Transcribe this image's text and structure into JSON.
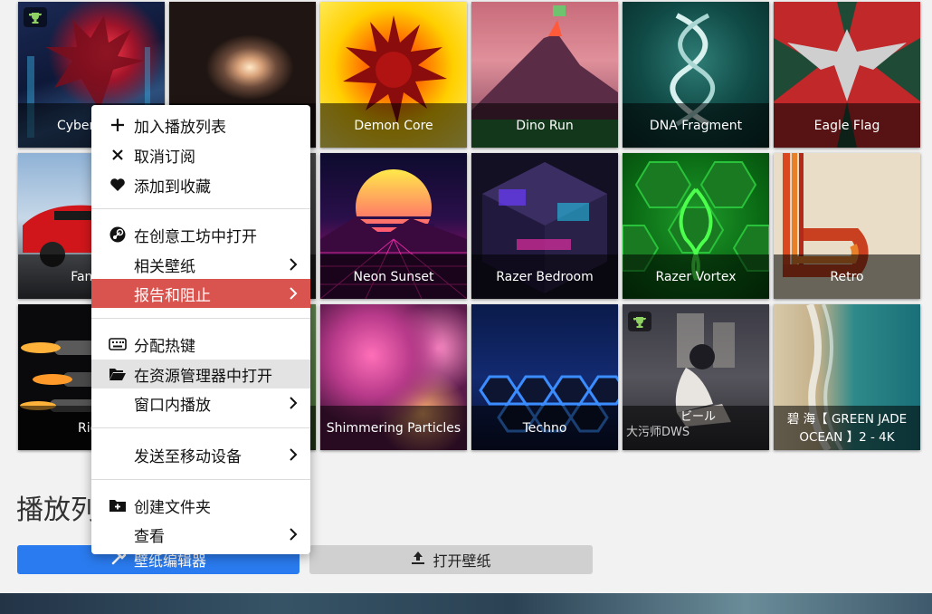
{
  "wallpapers": [
    {
      "title": "Cyberpunk",
      "selected": true,
      "trophy": true
    },
    {
      "title": ""
    },
    {
      "title": "Demon Core"
    },
    {
      "title": "Dino Run"
    },
    {
      "title": "DNA Fragment"
    },
    {
      "title": "Eagle Flag"
    },
    {
      "title": "Fantas"
    },
    {
      "title": ""
    },
    {
      "title": "Neon Sunset"
    },
    {
      "title": "Razer Bedroom"
    },
    {
      "title": "Razer Vortex"
    },
    {
      "title": "Retro"
    },
    {
      "title": "Rice"
    },
    {
      "title": ""
    },
    {
      "title": "Shimmering Particles"
    },
    {
      "title": "Techno"
    },
    {
      "title": "ビール",
      "trophy": true
    },
    {
      "title": "碧 海【 GREEN JADE OCEAN 】2 - 4K"
    }
  ],
  "artwork_text": {
    "anime_watermark": "大污师DWS"
  },
  "playlist": {
    "title": "播放列"
  },
  "buttons": {
    "editor": "壁纸编辑器",
    "open": "打开壁纸"
  },
  "context_menu": {
    "items": [
      {
        "label": "加入播放列表",
        "icon": "plus-icon"
      },
      {
        "label": "取消订阅",
        "icon": "x-icon"
      },
      {
        "label": "添加到收藏",
        "icon": "heart-icon"
      },
      {
        "label": "在创意工坊中打开",
        "icon": "steam-icon"
      },
      {
        "label": "相关壁纸",
        "submenu": true
      },
      {
        "label": "报告和阻止",
        "submenu": true,
        "highlighted": true
      },
      {
        "label": "分配热键",
        "icon": "keyboard-icon"
      },
      {
        "label": "在资源管理器中打开",
        "icon": "folder-open-icon",
        "hovered": true
      },
      {
        "label": "窗口内播放",
        "submenu": true
      },
      {
        "label": "发送至移动设备",
        "submenu": true
      },
      {
        "label": "创建文件夹",
        "icon": "folder-plus-icon"
      },
      {
        "label": "查看",
        "submenu": true
      }
    ]
  },
  "colors": {
    "accent": "#2a7bef",
    "danger": "#d9534f",
    "selected_outline": "#2b7fe8"
  }
}
